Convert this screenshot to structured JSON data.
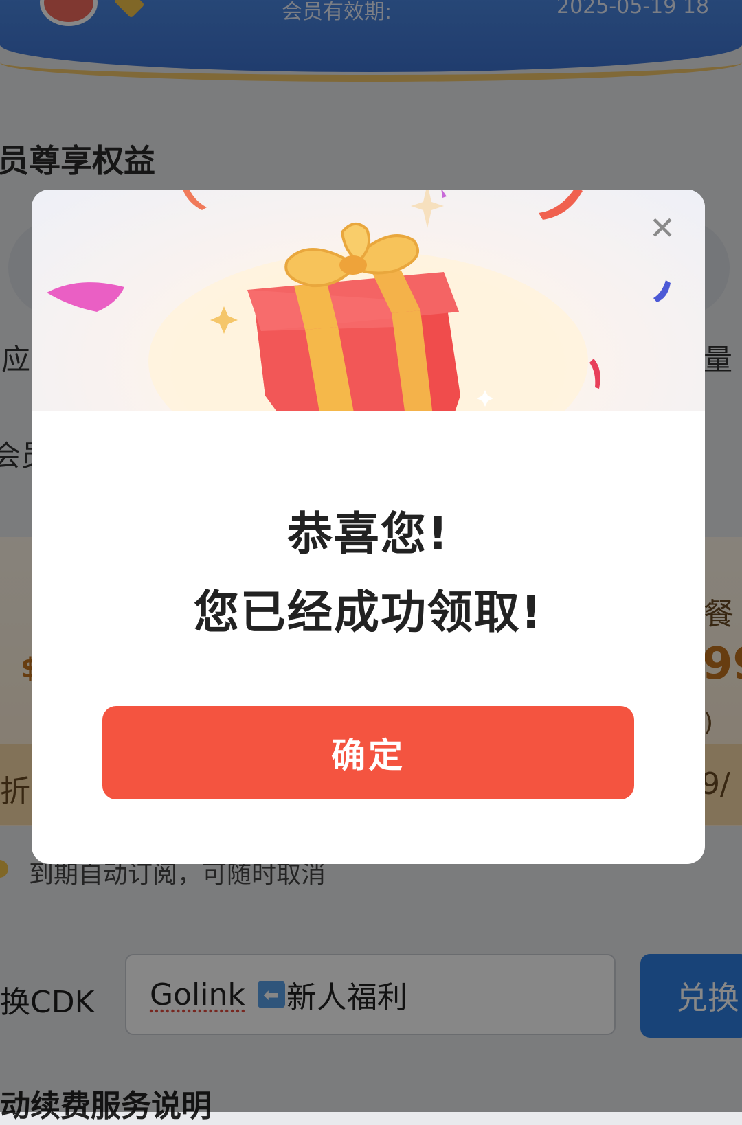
{
  "background": {
    "banner": {
      "expiry_label": "会员有效期:",
      "expiry_date": "2025-05-19 18"
    },
    "section_title": "员尊享权益",
    "left_fragments": [
      "应",
      "会员"
    ],
    "right_fragments": [
      "量",
      "餐"
    ],
    "offer": {
      "left_price_fragment": "$",
      "right_price_fragment": "99",
      "right_paren": ")",
      "strip_left": "折",
      "strip_right": "9/"
    },
    "auto_renew_text": "到期自动订阅，可随时取消",
    "cdk": {
      "label": "换CDK",
      "input_word": "Golink",
      "input_rest": "新人福利",
      "redeem_label": "兑换"
    },
    "footer_title": "动续费服务说明"
  },
  "modal": {
    "title_line1": "恭喜您!",
    "title_line2": "您已经成功领取!",
    "confirm_label": "确定",
    "close_glyph": "✕"
  },
  "colors": {
    "confirm": "#f45440",
    "redeem": "#2f7fe3",
    "banner": "#4a86e0",
    "gift_red": "#f04c4c",
    "gift_ribbon": "#f5b84a"
  }
}
